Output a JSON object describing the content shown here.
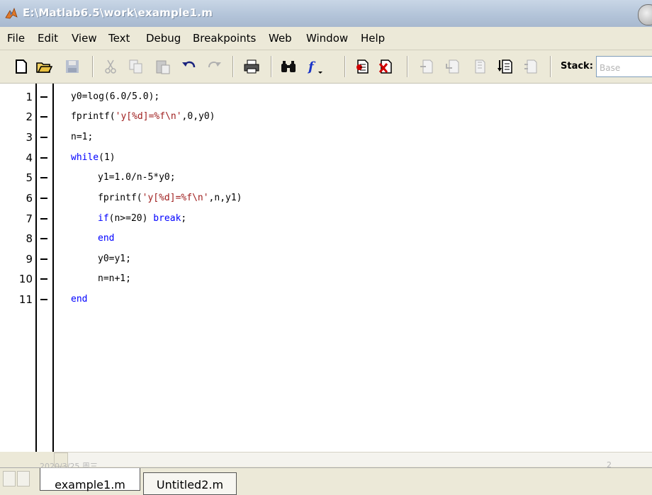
{
  "window": {
    "title": "E:\\Matlab6.5\\work\\example1.m"
  },
  "menu": [
    "File",
    "Edit",
    "View",
    "Text",
    "Debug",
    "Breakpoints",
    "Web",
    "Window",
    "Help"
  ],
  "toolbar": {
    "icons": [
      "new-file-icon",
      "open-folder-icon",
      "save-icon",
      "cut-icon",
      "copy-icon",
      "paste-icon",
      "undo-icon",
      "redo-icon",
      "print-icon",
      "find-icon",
      "function-icon",
      "set-breakpoint-icon",
      "clear-breakpoints-icon",
      "step-icon",
      "step-in-icon",
      "step-out-icon",
      "continue-icon",
      "exit-debug-icon"
    ],
    "stack_label": "Stack:",
    "stack_value": "Base"
  },
  "editor": {
    "lines": [
      {
        "n": "1"
      },
      {
        "n": "2"
      },
      {
        "n": "3"
      },
      {
        "n": "4"
      },
      {
        "n": "5"
      },
      {
        "n": "6"
      },
      {
        "n": "7"
      },
      {
        "n": "8"
      },
      {
        "n": "9"
      },
      {
        "n": "10"
      },
      {
        "n": "11"
      }
    ],
    "code": {
      "l1": "y0=log(6.0/5.0);",
      "l2_a": "fprintf(",
      "l2_b": "'y[%d]=%f\\n'",
      "l2_c": ",0,y0)",
      "l3": "n=1;",
      "l4_a": "while",
      "l4_b": "(1)",
      "l5": "y1=1.0/n-5*y0;",
      "l6_a": "fprintf(",
      "l6_b": "'y[%d]=%f\\n'",
      "l6_c": ",n,y1)",
      "l7_a": "if",
      "l7_b": "(n>=20) ",
      "l7_c": "break",
      "l7_d": ";",
      "l8": "end",
      "l9": "y0=y1;",
      "l10": "n=n+1;",
      "l11": "end"
    }
  },
  "footer": {
    "date": "2020/3/25 周三",
    "page": "2"
  },
  "tabs": [
    {
      "label": "example1.m",
      "active": true
    },
    {
      "label": "Untitled2.m",
      "active": false
    }
  ]
}
